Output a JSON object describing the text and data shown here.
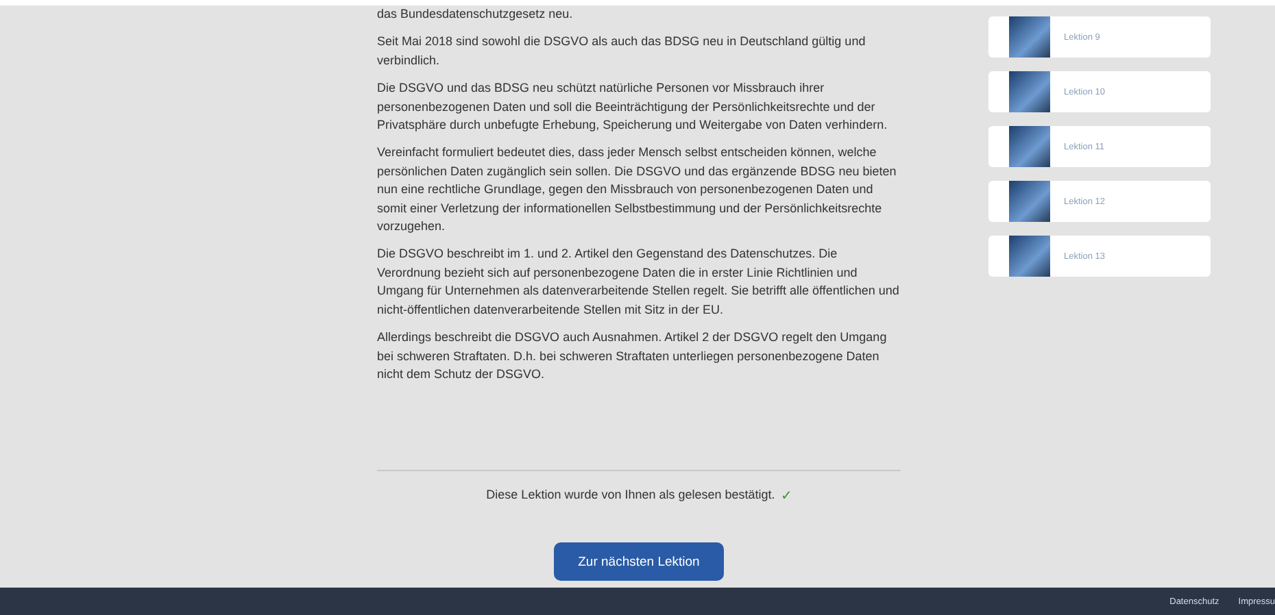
{
  "article": {
    "paragraphs": [
      "das Bundesdatenschutzgesetz neu.",
      "Seit Mai 2018 sind sowohl die DSGVO als auch das BDSG neu in Deutschland gültig und verbindlich.",
      "Die DSGVO und das BDSG neu schützt natürliche Personen vor Missbrauch ihrer personenbezogenen Daten und soll die Beeinträchtigung der Persönlichkeitsrechte und der Privatsphäre durch unbefugte Erhebung, Speicherung und Weitergabe von Daten verhindern.",
      "Vereinfacht formuliert bedeutet dies, dass jeder Mensch selbst entscheiden können, welche persönlichen Daten zugänglich sein sollen. Die DSGVO und das ergänzende BDSG neu bieten nun eine rechtliche Grundlage, gegen den Missbrauch von personenbezogenen Daten und somit einer Verletzung der informationellen Selbstbestimmung und der Persönlichkeitsrechte  vorzugehen.",
      "Die DSGVO beschreibt im 1. und 2. Artikel den Gegenstand des Datenschutzes. Die Verordnung bezieht sich auf personenbezogene Daten die in erster Linie Richtlinien und Umgang für Unternehmen als datenverarbeitende Stellen regelt. Sie betrifft alle öffentlichen und nicht-öffentlichen datenverarbeitende Stellen mit Sitz in der EU.",
      "Allerdings beschreibt die DSGVO auch Ausnahmen. Artikel 2 der DSGVO regelt den Umgang bei schweren Straftaten. D.h. bei schweren Straftaten unterliegen personenbezogene Daten nicht dem Schutz der DSGVO."
    ],
    "confirmation": {
      "text": "Diese Lektion wurde von Ihnen als gelesen bestätigt.",
      "mark": "✓",
      "confirmed": true
    },
    "next_button": "Zur nächsten Lektion"
  },
  "sidebar": {
    "lessons": [
      {
        "label": "Lektion 9"
      },
      {
        "label": "Lektion 10"
      },
      {
        "label": "Lektion 11"
      },
      {
        "label": "Lektion 12"
      },
      {
        "label": "Lektion 13"
      }
    ]
  },
  "footer": {
    "links": [
      "Datenschutz",
      "Impressu"
    ]
  }
}
